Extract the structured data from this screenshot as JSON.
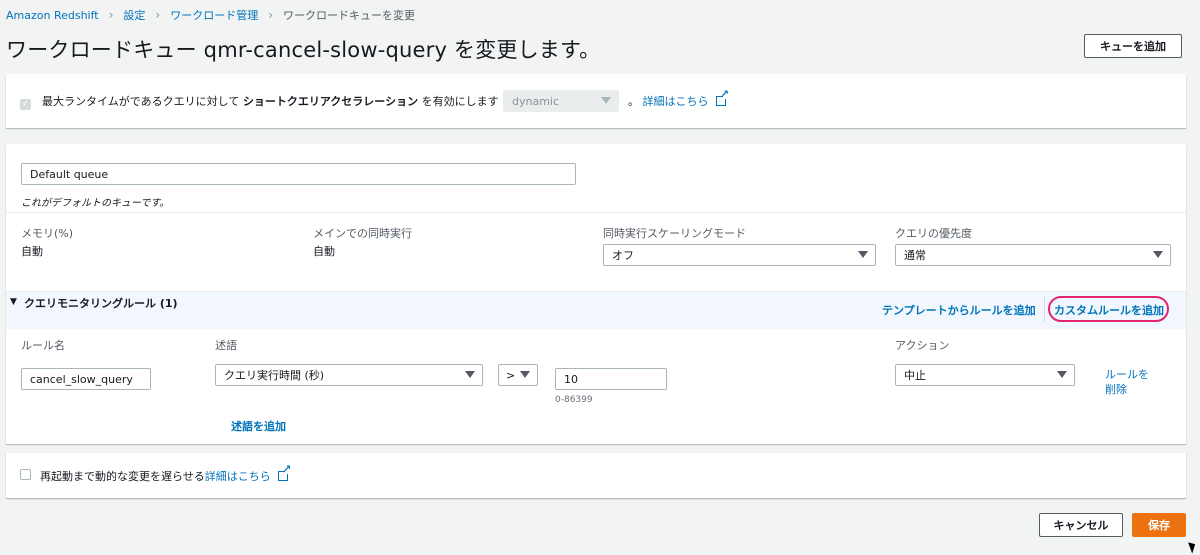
{
  "breadcrumb": {
    "items": [
      "Amazon Redshift",
      "設定",
      "ワークロード管理",
      "ワークロードキューを変更"
    ]
  },
  "page": {
    "title": "ワークロードキュー qmr-cancel-slow-query を変更します。",
    "add_queue_button": "キューを追加"
  },
  "sqa": {
    "prefix": "最大ランタイムがであるクエリに対して",
    "emphasis": "ショートクエリアクセラレーション",
    "suffix": "を有効にします",
    "mode_value": "dynamic",
    "period": "。",
    "details_link": "詳細はこちら",
    "checked": true
  },
  "queue": {
    "name_value": "Default queue",
    "description": "これがデフォルトのキューです。",
    "memory_label": "メモリ(%)",
    "memory_value": "自動",
    "concurrency_label": "メインでの同時実行",
    "concurrency_value": "自動",
    "scaling_label": "同時実行スケーリングモード",
    "scaling_value": "オフ",
    "priority_label": "クエリの優先度",
    "priority_value": "通常"
  },
  "rules": {
    "header": "クエリモニタリングルール (1)",
    "add_from_template": "テンプレートからルールを追加",
    "add_custom": "カスタムルールを追加",
    "col_rule_name": "ルール名",
    "col_predicate": "述語",
    "col_action": "アクション",
    "rule_name_value": "cancel_slow_query",
    "metric_value": "クエリ実行時間 (秒)",
    "operator_value": ">",
    "threshold_value": "10",
    "threshold_range": "0-86399",
    "action_value": "中止",
    "remove_rule": "ルールを削除",
    "add_predicate": "述語を追加"
  },
  "defer": {
    "label": "再起動まで動的な変更を遅らせる",
    "details_link": "詳細はこちら",
    "checked": false
  },
  "footer": {
    "cancel": "キャンセル",
    "save": "保存"
  },
  "colors": {
    "link": "#0073bb",
    "primary": "#ec7211",
    "highlight": "#e3256b",
    "rules_header_bg": "#f1f7fd"
  }
}
